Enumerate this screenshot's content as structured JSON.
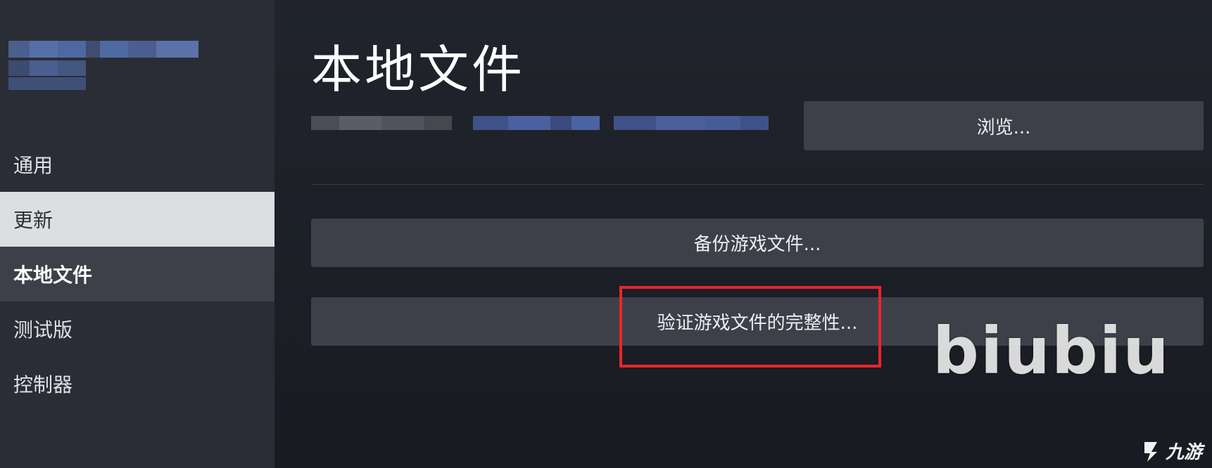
{
  "sidebar": {
    "items": [
      {
        "id": "general",
        "label": "通用",
        "state": "normal"
      },
      {
        "id": "updates",
        "label": "更新",
        "state": "hover"
      },
      {
        "id": "local-files",
        "label": "本地文件",
        "state": "selected"
      },
      {
        "id": "betas",
        "label": "测试版",
        "state": "normal"
      },
      {
        "id": "controller",
        "label": "控制器",
        "state": "normal"
      }
    ]
  },
  "main": {
    "title": "本地文件",
    "browse_label": "浏览...",
    "backup_label": "备份游戏文件...",
    "verify_label": "验证游戏文件的完整性..."
  },
  "overlay": {
    "watermark": "biubiu",
    "corner_logo_text": "九游",
    "highlight_color": "#e8262a"
  },
  "colors": {
    "sidebar_bg": "#2a2d35",
    "main_bg": "#1b1e26",
    "button_bg": "#3d4049",
    "hover_bg": "#dcdfe2",
    "selected_bg": "#3d4048"
  }
}
